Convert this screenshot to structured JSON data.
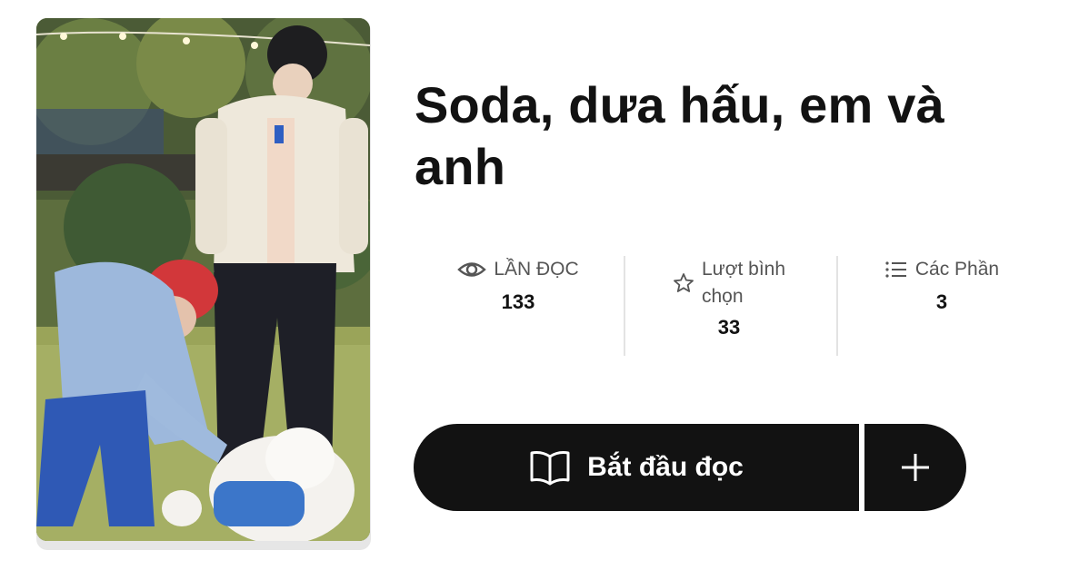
{
  "story": {
    "title": "Soda, dưa hấu, em và anh",
    "cover_alt": "Story cover photo"
  },
  "stats": {
    "reads": {
      "label": "LẦN ĐỌC",
      "value": "133",
      "icon": "eye-icon"
    },
    "votes": {
      "label_line1": "Lượt bình",
      "label_line2": "chọn",
      "value": "33",
      "icon": "star-icon"
    },
    "parts": {
      "label": "Các Phần",
      "value": "3",
      "icon": "list-icon"
    }
  },
  "actions": {
    "start_reading_label": "Bắt đầu đọc",
    "start_reading_icon": "book-open-icon",
    "add_icon": "plus-icon"
  },
  "colors": {
    "button_bg": "#121212",
    "text_primary": "#121212",
    "text_secondary": "#555555"
  }
}
